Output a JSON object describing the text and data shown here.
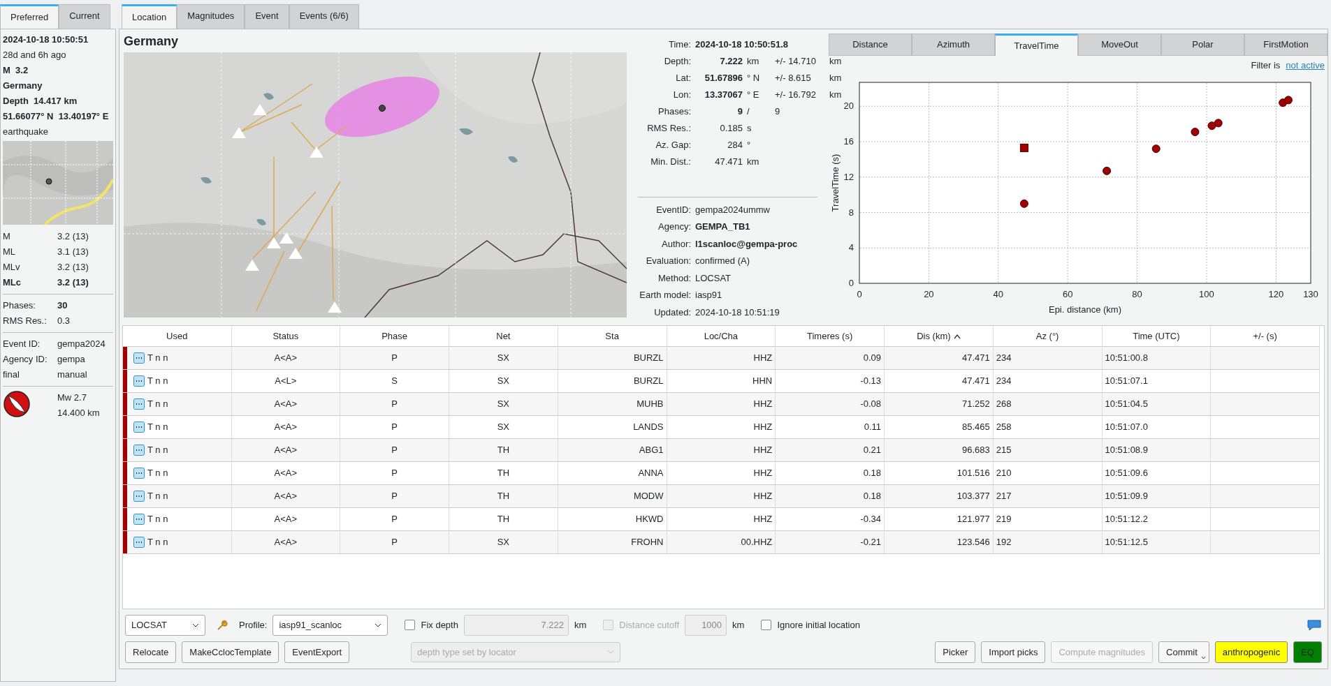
{
  "side_tabs": [
    {
      "label": "Preferred",
      "selected": true
    },
    {
      "label": "Current",
      "selected": false
    }
  ],
  "summary": [
    {
      "text": "2024-10-18 10:50:51",
      "bold": true
    },
    {
      "text": "28d and 6h ago",
      "bold": false
    },
    {
      "text": "M  3.2",
      "bold": true
    },
    {
      "text": "Germany",
      "bold": true
    },
    {
      "text": "Depth  14.417 km",
      "bold": true
    },
    {
      "text": "51.66077° N  13.40197° E",
      "bold": true
    },
    {
      "text": "earthquake",
      "bold": false
    }
  ],
  "magnitudes": [
    {
      "type": "M",
      "value": "3.2 (13)",
      "preferred": false
    },
    {
      "type": "ML",
      "value": "3.1 (13)",
      "preferred": false
    },
    {
      "type": "MLv",
      "value": "3.2 (13)",
      "preferred": false
    },
    {
      "type": "MLc",
      "value": "3.2 (13)",
      "preferred": true
    }
  ],
  "stats": [
    {
      "label": "Phases:",
      "value": "30",
      "bold": true
    },
    {
      "label": "RMS Res.:",
      "value": "0.3",
      "bold": false
    }
  ],
  "ids": [
    {
      "label": "Event ID:",
      "value": "gempa2024"
    },
    {
      "label": "Agency ID:",
      "value": "gempa"
    },
    {
      "label": "final",
      "value": "manual"
    }
  ],
  "focal_mechanism": {
    "lines": [
      "Mw 2.7",
      "14.400 km"
    ]
  },
  "main_tabs": [
    {
      "label": "Location",
      "selected": true
    },
    {
      "label": "Magnitudes",
      "selected": false
    },
    {
      "label": "Event",
      "selected": false
    },
    {
      "label": "Events (6/6)",
      "selected": false
    }
  ],
  "region": "Germany",
  "origin": [
    {
      "label": "Time:",
      "value": "2024-10-18 10:50:51.8",
      "bold": true
    },
    {
      "label": "Depth:",
      "value": "7.222",
      "bold": true,
      "unit": "km",
      "error": "+/- 14.710",
      "error_unit": "km"
    },
    {
      "label": "Lat:",
      "value": "51.67896",
      "bold": true,
      "unit": "° N",
      "error": "+/- 8.615",
      "error_unit": "km"
    },
    {
      "label": "Lon:",
      "value": "13.37067",
      "bold": true,
      "unit": "° E",
      "error": "+/- 16.792",
      "error_unit": "km"
    },
    {
      "label": "Phases:",
      "value": "9",
      "bold": true,
      "unit": "/",
      "error": "9"
    },
    {
      "label": "RMS Res.:",
      "value": "0.185",
      "bold": false,
      "unit": "s"
    },
    {
      "label": "Az. Gap:",
      "value": "284",
      "bold": false,
      "unit": "°"
    },
    {
      "label": "Min. Dist.:",
      "value": "47.471",
      "bold": false,
      "unit": "km"
    }
  ],
  "event_info": [
    {
      "label": "EventID:",
      "value": "gempa2024ummw",
      "bold": false
    },
    {
      "label": "Agency:",
      "value": "GEMPA_TB1",
      "bold": true
    },
    {
      "label": "Author:",
      "value": "l1scanloc@gempa-proc",
      "bold": true
    },
    {
      "label": "Evaluation:",
      "value": "confirmed (A)",
      "bold": false
    },
    {
      "label": "Method:",
      "value": "LOCSAT",
      "bold": false
    },
    {
      "label": "Earth model:",
      "value": "iasp91",
      "bold": false
    },
    {
      "label": "Updated:",
      "value": "2024-10-18 10:51:19",
      "bold": false
    }
  ],
  "plot_tabs": [
    {
      "label": "Distance",
      "selected": false
    },
    {
      "label": "Azimuth",
      "selected": false
    },
    {
      "label": "TravelTime",
      "selected": true
    },
    {
      "label": "MoveOut",
      "selected": false
    },
    {
      "label": "Polar",
      "selected": false
    },
    {
      "label": "FirstMotion",
      "selected": false
    }
  ],
  "filter": {
    "label": "Filter is",
    "link": "not active"
  },
  "chart_data": {
    "type": "scatter",
    "grid": true,
    "xlabel": "Epi. distance (km)",
    "ylabel": "TravelTime (s)",
    "xlim": [
      0,
      130
    ],
    "ylim": [
      0,
      22.7
    ],
    "xticks": [
      0,
      20,
      40,
      60,
      80,
      100,
      120,
      130
    ],
    "yticks": [
      0,
      4,
      8,
      12,
      16,
      20
    ],
    "series": [
      {
        "color": "#a00000",
        "x": [
          47.471,
          71.252,
          85.465,
          96.683,
          101.516,
          103.377,
          121.977,
          123.546
        ],
        "values": [
          9.0,
          12.7,
          15.2,
          17.1,
          17.8,
          18.1,
          20.4,
          20.7
        ]
      },
      {
        "color": "#a00000",
        "x": [
          47.471
        ],
        "values": [
          15.3
        ]
      }
    ]
  },
  "table": {
    "columns": [
      {
        "label": "Used",
        "sorted": false
      },
      {
        "label": "Status",
        "sorted": false
      },
      {
        "label": "Phase",
        "sorted": false
      },
      {
        "label": "Net",
        "sorted": false
      },
      {
        "label": "Sta",
        "sorted": false
      },
      {
        "label": "Loc/Cha",
        "sorted": false
      },
      {
        "label": "Timeres (s)",
        "sorted": false
      },
      {
        "label": "Dis (km)",
        "sorted": true
      },
      {
        "label": "Az (°)",
        "sorted": false
      },
      {
        "label": "Time (UTC)",
        "sorted": false
      },
      {
        "label": "+/- (s)",
        "sorted": false
      }
    ],
    "rows": [
      [
        "T n n",
        "A<A>",
        "P",
        "SX",
        "BURZL",
        "HHZ",
        "0.09",
        "47.471",
        "234",
        "10:51:00.8"
      ],
      [
        "T n n",
        "A<L>",
        "S",
        "SX",
        "BURZL",
        "HHN",
        "-0.13",
        "47.471",
        "234",
        "10:51:07.1"
      ],
      [
        "T n n",
        "A<A>",
        "P",
        "SX",
        "MUHB",
        "HHZ",
        "-0.08",
        "71.252",
        "268",
        "10:51:04.5"
      ],
      [
        "T n n",
        "A<A>",
        "P",
        "SX",
        "LANDS",
        "HHZ",
        "0.11",
        "85.465",
        "258",
        "10:51:07.0"
      ],
      [
        "T n n",
        "A<A>",
        "P",
        "TH",
        "ABG1",
        "HHZ",
        "0.21",
        "96.683",
        "215",
        "10:51:08.9"
      ],
      [
        "T n n",
        "A<A>",
        "P",
        "TH",
        "ANNA",
        "HHZ",
        "0.18",
        "101.516",
        "210",
        "10:51:09.6"
      ],
      [
        "T n n",
        "A<A>",
        "P",
        "TH",
        "MODW",
        "HHZ",
        "0.18",
        "103.377",
        "217",
        "10:51:09.9"
      ],
      [
        "T n n",
        "A<A>",
        "P",
        "TH",
        "HKWD",
        "HHZ",
        "-0.34",
        "121.977",
        "219",
        "10:51:12.2"
      ],
      [
        "T n n",
        "A<A>",
        "P",
        "SX",
        "FROHN",
        "00.HHZ",
        "-0.21",
        "123.546",
        "192",
        "10:51:12.5"
      ]
    ]
  },
  "locator": {
    "value": "LOCSAT"
  },
  "profile": {
    "label": "Profile:",
    "value": "iasp91_scanloc"
  },
  "fix_depth": {
    "label": "Fix depth",
    "checked": false,
    "value": "7.222",
    "disabled": true,
    "unit": "km"
  },
  "distance_cutoff": {
    "label": "Distance cutoff",
    "checked": false,
    "disabled": true,
    "value": "1000",
    "unit": "km"
  },
  "ignore_initial": {
    "label": "Ignore initial location",
    "checked": false
  },
  "left_buttons": [
    {
      "label": "Relocate"
    },
    {
      "label": "MakeCclocTemplate"
    },
    {
      "label": "EventExport"
    }
  ],
  "depth_type": {
    "value": "depth type set by locator",
    "disabled": true
  },
  "right_buttons": [
    {
      "label": "Picker",
      "disabled": false,
      "menu": false
    },
    {
      "label": "Import picks",
      "disabled": false,
      "menu": false
    },
    {
      "label": "Compute magnitudes",
      "disabled": true,
      "menu": false
    },
    {
      "label": "Commit",
      "disabled": false,
      "menu": true
    },
    {
      "label": "anthropogenic",
      "disabled": false,
      "menu": false,
      "color": "#ffff00"
    },
    {
      "label": "EQ",
      "disabled": false,
      "menu": false,
      "color": "#008000"
    }
  ]
}
